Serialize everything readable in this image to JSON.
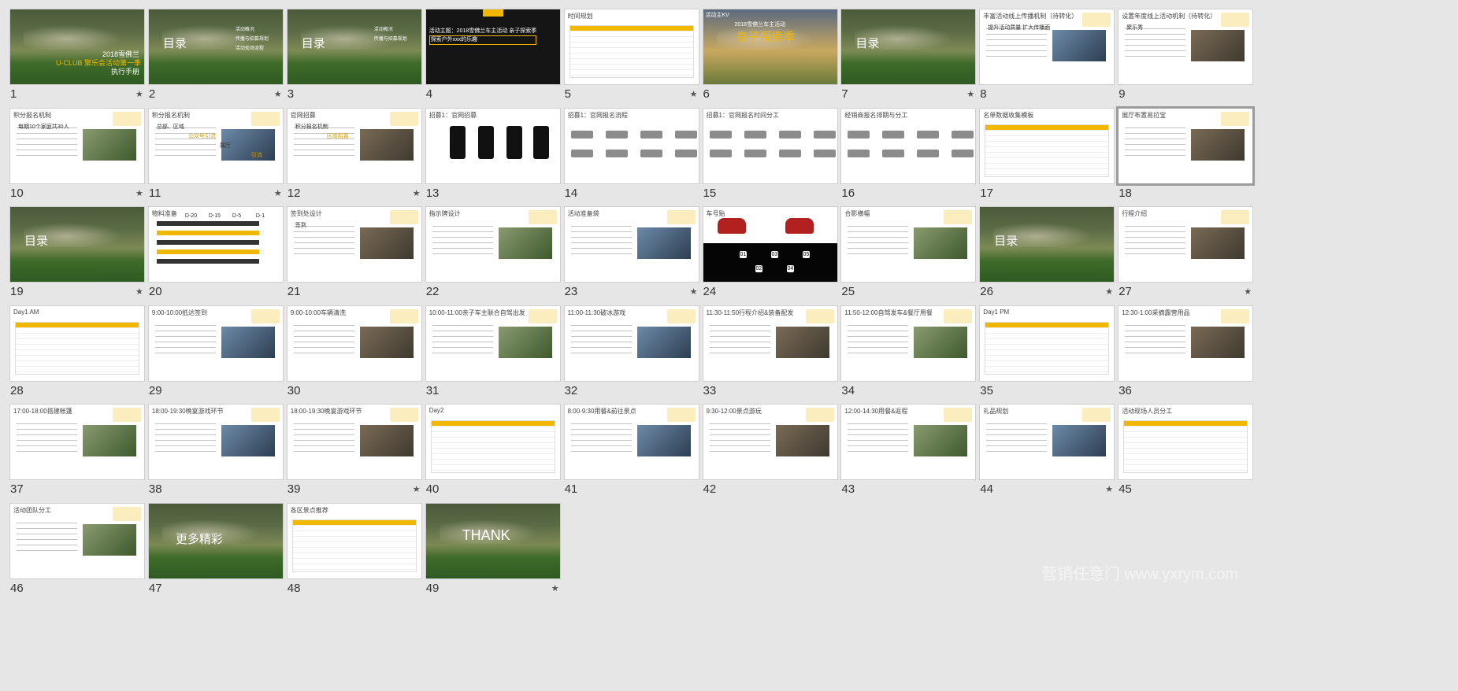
{
  "window": {
    "title": "Slide Sorter"
  },
  "slides": [
    {
      "num": "1",
      "star": true,
      "kind": "photo",
      "lines": [
        "2018雪佛兰",
        "U-CLUB 聚乐会活动第一季",
        "执行手册"
      ]
    },
    {
      "num": "2",
      "star": true,
      "kind": "photo",
      "lines": [
        "目录",
        "活动概况",
        "传播与招募规划",
        "活动现场流程"
      ]
    },
    {
      "num": "3",
      "star": false,
      "kind": "photo",
      "lines": [
        "目录",
        "活动概况",
        "传播与招募规划"
      ]
    },
    {
      "num": "4",
      "star": false,
      "kind": "dark",
      "lines": [
        "活动主题：2018雪佛兰车主活动 亲子探索季",
        "探索户外xxx的乐趣"
      ]
    },
    {
      "num": "5",
      "star": true,
      "kind": "table",
      "lines": [
        "时间规划"
      ]
    },
    {
      "num": "6",
      "star": false,
      "kind": "kv",
      "lines": [
        "活动主KV",
        "2018雪佛兰车主活动",
        "亲子探索季"
      ]
    },
    {
      "num": "7",
      "star": true,
      "kind": "photo",
      "lines": [
        "目录"
      ]
    },
    {
      "num": "8",
      "star": false,
      "kind": "text",
      "lines": [
        "丰富活动线上传播机制（待转化）",
        "提升活动质量 扩大传播面"
      ]
    },
    {
      "num": "9",
      "star": false,
      "kind": "text",
      "lines": [
        "设置年度线上活动机制（待转化）",
        "聚乐秀"
      ]
    },
    {
      "num": "10",
      "star": true,
      "kind": "text",
      "lines": [
        "积分报名机制",
        "每期10个家庭共30人"
      ]
    },
    {
      "num": "11",
      "star": true,
      "kind": "text",
      "lines": [
        "积分报名机制",
        "总部、区域",
        "公众号引流",
        "展厅",
        "引流"
      ]
    },
    {
      "num": "12",
      "star": true,
      "kind": "text",
      "lines": [
        "官网招募",
        "积分报名机制",
        "区域招募"
      ]
    },
    {
      "num": "13",
      "star": false,
      "kind": "phones",
      "lines": [
        "招募1：官网招募"
      ]
    },
    {
      "num": "14",
      "star": false,
      "kind": "flow",
      "lines": [
        "招募1：官网报名流程"
      ]
    },
    {
      "num": "15",
      "star": false,
      "kind": "flow",
      "lines": [
        "招募1：官网报名时间分工"
      ]
    },
    {
      "num": "16",
      "star": false,
      "kind": "flow",
      "lines": [
        "经销商报名排期与分工"
      ]
    },
    {
      "num": "17",
      "star": false,
      "kind": "table",
      "lines": [
        "名单数据收集模板"
      ]
    },
    {
      "num": "18",
      "star": false,
      "kind": "text",
      "lines": [
        "展厅布置易拉宝"
      ]
    },
    {
      "num": "19",
      "star": true,
      "kind": "photo",
      "lines": [
        "目录"
      ]
    },
    {
      "num": "20",
      "star": false,
      "kind": "timeline",
      "lines": [
        "物料准备",
        "D-20",
        "D-15",
        "D-5",
        "D-1"
      ]
    },
    {
      "num": "21",
      "star": false,
      "kind": "text",
      "lines": [
        "签到处设计",
        "签到"
      ]
    },
    {
      "num": "22",
      "star": false,
      "kind": "text",
      "lines": [
        "指示牌设计"
      ]
    },
    {
      "num": "23",
      "star": true,
      "kind": "text",
      "lines": [
        "活动准备袋"
      ]
    },
    {
      "num": "24",
      "star": false,
      "kind": "cars",
      "lines": [
        "车号贴",
        "01",
        "02",
        "03",
        "04",
        "05"
      ]
    },
    {
      "num": "25",
      "star": false,
      "kind": "text",
      "lines": [
        "合影横幅"
      ]
    },
    {
      "num": "26",
      "star": true,
      "kind": "photo",
      "lines": [
        "目录"
      ]
    },
    {
      "num": "27",
      "star": true,
      "kind": "text",
      "lines": [
        "行程介绍"
      ]
    },
    {
      "num": "28",
      "star": false,
      "kind": "table",
      "lines": [
        "Day1 AM"
      ]
    },
    {
      "num": "29",
      "star": false,
      "kind": "text",
      "lines": [
        "9:00-10:00抵达签到"
      ]
    },
    {
      "num": "30",
      "star": false,
      "kind": "text",
      "lines": [
        "9:00-10:00车辆清洗"
      ]
    },
    {
      "num": "31",
      "star": false,
      "kind": "text",
      "lines": [
        "10:00-11:00亲子车主联合自驾出发"
      ]
    },
    {
      "num": "32",
      "star": false,
      "kind": "text",
      "lines": [
        "11:00-11:30破冰游戏"
      ]
    },
    {
      "num": "33",
      "star": false,
      "kind": "text",
      "lines": [
        "11:30-11:50行程介绍&装备配发"
      ]
    },
    {
      "num": "34",
      "star": false,
      "kind": "text",
      "lines": [
        "11:50-12:00自驾发车&餐厅用餐"
      ]
    },
    {
      "num": "35",
      "star": false,
      "kind": "table",
      "lines": [
        "Day1 PM"
      ]
    },
    {
      "num": "36",
      "star": false,
      "kind": "text",
      "lines": [
        "12:30-1:00采摘露营用品"
      ]
    },
    {
      "num": "37",
      "star": false,
      "kind": "text",
      "lines": [
        "17:00-18:00搭建帐篷"
      ]
    },
    {
      "num": "38",
      "star": false,
      "kind": "text",
      "lines": [
        "18:00-19:30晚宴游戏环节"
      ]
    },
    {
      "num": "39",
      "star": true,
      "kind": "text",
      "lines": [
        "18:00-19:30晚宴游戏环节"
      ]
    },
    {
      "num": "40",
      "star": false,
      "kind": "table",
      "lines": [
        "Day2"
      ]
    },
    {
      "num": "41",
      "star": false,
      "kind": "text",
      "lines": [
        "8:00-9:30用餐&前往景点"
      ]
    },
    {
      "num": "42",
      "star": false,
      "kind": "text",
      "lines": [
        "9:30-12:00景点游玩"
      ]
    },
    {
      "num": "43",
      "star": false,
      "kind": "text",
      "lines": [
        "12:00-14:30用餐&返程"
      ]
    },
    {
      "num": "44",
      "star": true,
      "kind": "text",
      "lines": [
        "礼品规划"
      ]
    },
    {
      "num": "45",
      "star": false,
      "kind": "table",
      "lines": [
        "活动现场人员分工"
      ]
    },
    {
      "num": "46",
      "star": false,
      "kind": "text",
      "lines": [
        "活动团队分工"
      ]
    },
    {
      "num": "47",
      "star": false,
      "kind": "photo",
      "lines": [
        "更多精彩"
      ]
    },
    {
      "num": "48",
      "star": false,
      "kind": "table",
      "lines": [
        "各区景点推荐"
      ]
    },
    {
      "num": "49",
      "star": true,
      "kind": "photo",
      "lines": [
        "THANK"
      ]
    }
  ],
  "watermark": "营销任意门 www.yxrym.com",
  "star_glyph": "★",
  "colors": {
    "accent": "#f2b800",
    "background": "#e6e6e6",
    "selected_border": "#9c9c9c"
  }
}
